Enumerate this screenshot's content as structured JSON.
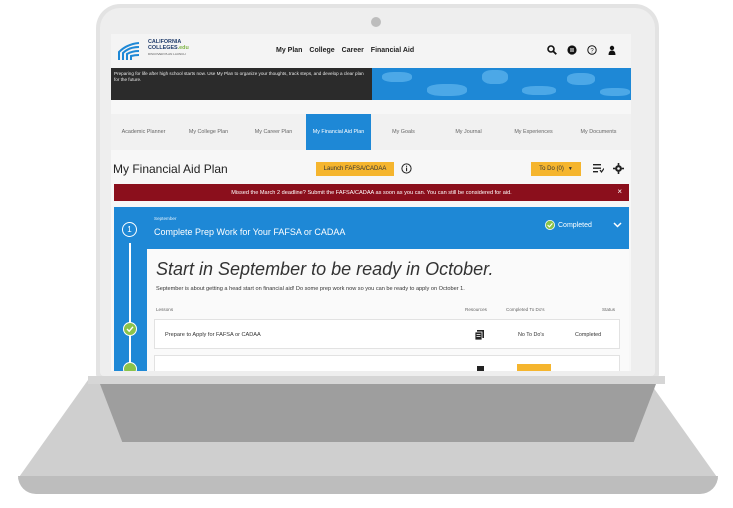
{
  "header": {
    "logo_line1": "CALIFORNIA",
    "logo_line2": "COLLEGES",
    "logo_edu": ".edu",
    "logo_tagline": "DISCOVER PLAN LAUNCH",
    "nav": [
      "My Plan",
      "College",
      "Career",
      "Financial Aid"
    ],
    "icons": [
      "search-icon",
      "notifications-icon",
      "help-icon",
      "account-icon"
    ]
  },
  "banner": {
    "text": "Preparing for life after high school starts now. Use My Plan to organize your thoughts, track steps, and develop a clear plan for the future."
  },
  "tabs": [
    {
      "label": "Academic Planner",
      "active": false
    },
    {
      "label": "My College Plan",
      "active": false
    },
    {
      "label": "My Career Plan",
      "active": false
    },
    {
      "label": "My Financial Aid Plan",
      "active": true
    },
    {
      "label": "My Goals",
      "active": false
    },
    {
      "label": "My Journal",
      "active": false
    },
    {
      "label": "My Experiences",
      "active": false
    },
    {
      "label": "My Documents",
      "active": false
    }
  ],
  "page": {
    "title": "My Financial Aid Plan",
    "launch_button": "Launch FAFSA/CADAA",
    "todo_button": "To Do (0)"
  },
  "alert": {
    "text": "Missed the March 2 deadline? Submit the FAFSA/CADAA as soon as you can. You can still be considered for aid.",
    "close": "×"
  },
  "step": {
    "number": "1",
    "month": "September",
    "title": "Complete Prep Work for Your FAFSA or CADAA",
    "status": "Completed",
    "headline": "Start in September to be ready in October.",
    "intro": "September is about getting a head start on financial aid! Do some prep work now so you can be ready to apply on October 1.",
    "columns": {
      "lessons": "Lessons",
      "resources": "Resources",
      "completed_todos": "Completed To Do's",
      "status": "Status"
    },
    "rows": [
      {
        "lesson": "Prepare to Apply for FAFSA or CADAA",
        "todos": "No To Do's",
        "status": "Completed"
      }
    ]
  },
  "colors": {
    "brand_blue": "#1e88d6",
    "accent_yellow": "#f5b52e",
    "alert_red": "#8b0f1c",
    "complete_green": "#8bc34a"
  }
}
